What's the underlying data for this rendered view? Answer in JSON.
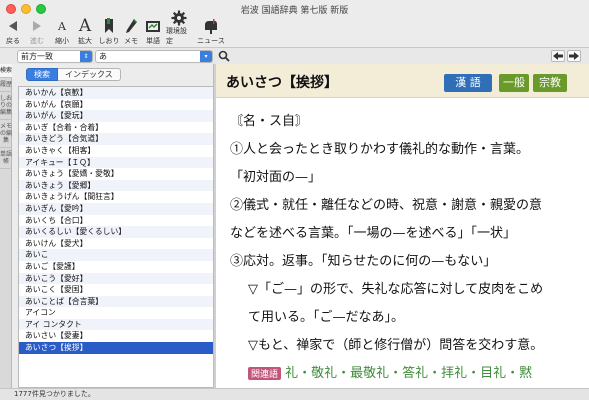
{
  "window": {
    "title": "岩波 国語辞典 第七版 新版"
  },
  "toolbar": {
    "back_label": "戻る",
    "forward_label": "進む",
    "shrink_label": "縮小",
    "enlarge_label": "拡大",
    "bookmark_label": "しおり",
    "memo_label": "メモ",
    "wordbook_label": "単語",
    "settings_label": "環境設定",
    "news_label": "ニュース"
  },
  "search": {
    "mode_value": "前方一致",
    "query_value": "あ"
  },
  "vertical_tabs": [
    "検索",
    "履歴",
    "しおりの編集",
    "メモの編集",
    "単語帳"
  ],
  "left": {
    "segment_search": "検索",
    "segment_index": "インデックス",
    "entries": [
      "あいかん【哀歓】",
      "あいがん【哀願】",
      "あいがん【愛玩】",
      "あいぎ【合着・合着】",
      "あいきどう【合気道】",
      "あいきゃく【相客】",
      "アイキュー【ＩＱ】",
      "あいきょう【愛嬌・愛敬】",
      "あいきょう【愛郷】",
      "あいきょうげん【間狂言】",
      "あいぎん【愛吟】",
      "あいくち【合口】",
      "あいくるしい【愛くるしい】",
      "あいけん【愛犬】",
      "あいこ",
      "あいご【愛護】",
      "あいこう【愛好】",
      "あいこく【愛国】",
      "あいことば【合言葉】",
      "アイコン",
      "アイ コンタクト",
      "あいさい【愛妻】",
      "あいさつ【挨拶】"
    ]
  },
  "entry": {
    "headword": "あいさつ【挨拶】",
    "badges": {
      "kanji": "漢 語",
      "general": "一般",
      "religion": "宗教"
    },
    "pos": "〘名・ス自〙",
    "lines": [
      "①人と会ったとき取りかわす儀礼的な動作・言葉。",
      "「初対面の—」",
      "②儀式・就任・離任などの時、祝意・謝意・親愛の意",
      "などを述べる言葉。「一場の—を述べる」「一状」",
      "③応対。返事。「知らせたのに何の—もない」",
      "▽「ご—」の形で、失礼な応答に対して皮肉をこめ",
      "て用いる。「ご—だなあ」。",
      "▽もと、禅家で（師と修行僧が）問答を交わす意。"
    ],
    "related_label": "関連語",
    "related_words": "礼・敬礼・最敬礼・答礼・拝礼・目礼・黙"
  },
  "status": {
    "count_text": "1777件見つかりました。"
  },
  "colors": {
    "accent": "#3a7ee0",
    "selection": "#2a5cc7",
    "kanji_badge": "#2f6fb8",
    "general_badge": "#6a9a2a",
    "religion_badge": "#6a9a2a",
    "related_tag": "#c2557a",
    "related_words": "#3f8c3a"
  }
}
